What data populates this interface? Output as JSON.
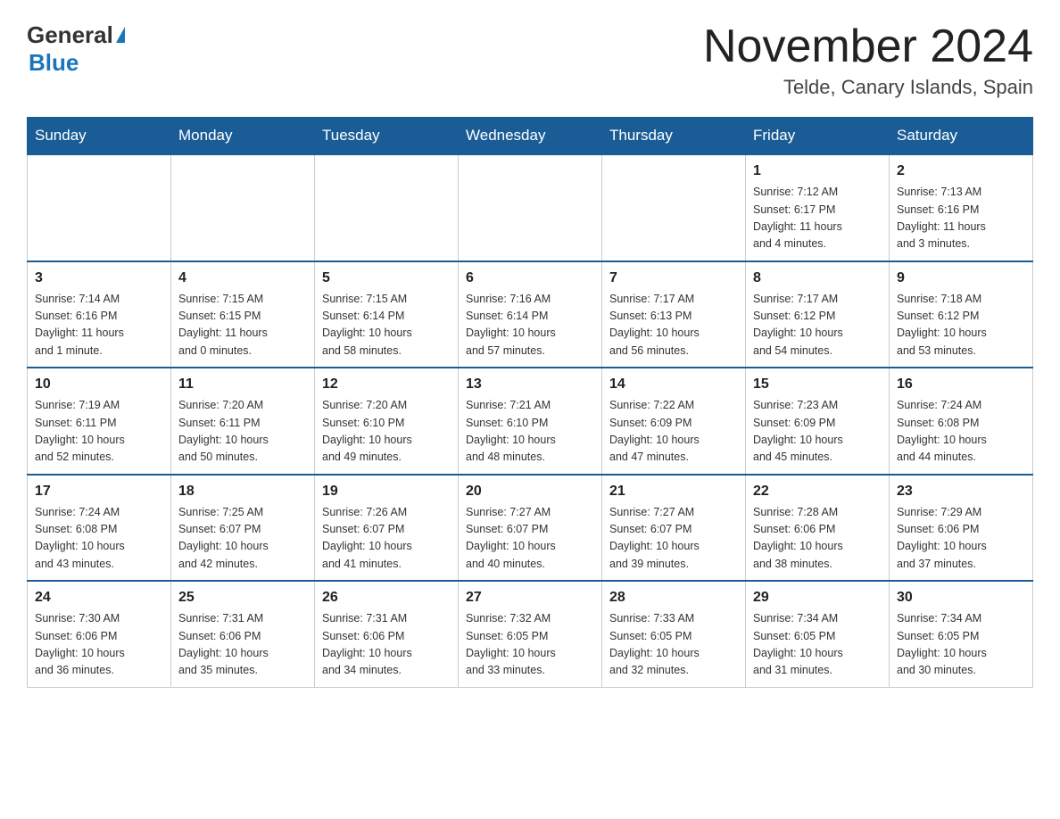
{
  "logo": {
    "general": "General",
    "blue": "Blue"
  },
  "title": {
    "month_year": "November 2024",
    "location": "Telde, Canary Islands, Spain"
  },
  "weekdays": [
    "Sunday",
    "Monday",
    "Tuesday",
    "Wednesday",
    "Thursday",
    "Friday",
    "Saturday"
  ],
  "weeks": [
    [
      {
        "day": "",
        "info": ""
      },
      {
        "day": "",
        "info": ""
      },
      {
        "day": "",
        "info": ""
      },
      {
        "day": "",
        "info": ""
      },
      {
        "day": "",
        "info": ""
      },
      {
        "day": "1",
        "info": "Sunrise: 7:12 AM\nSunset: 6:17 PM\nDaylight: 11 hours\nand 4 minutes."
      },
      {
        "day": "2",
        "info": "Sunrise: 7:13 AM\nSunset: 6:16 PM\nDaylight: 11 hours\nand 3 minutes."
      }
    ],
    [
      {
        "day": "3",
        "info": "Sunrise: 7:14 AM\nSunset: 6:16 PM\nDaylight: 11 hours\nand 1 minute."
      },
      {
        "day": "4",
        "info": "Sunrise: 7:15 AM\nSunset: 6:15 PM\nDaylight: 11 hours\nand 0 minutes."
      },
      {
        "day": "5",
        "info": "Sunrise: 7:15 AM\nSunset: 6:14 PM\nDaylight: 10 hours\nand 58 minutes."
      },
      {
        "day": "6",
        "info": "Sunrise: 7:16 AM\nSunset: 6:14 PM\nDaylight: 10 hours\nand 57 minutes."
      },
      {
        "day": "7",
        "info": "Sunrise: 7:17 AM\nSunset: 6:13 PM\nDaylight: 10 hours\nand 56 minutes."
      },
      {
        "day": "8",
        "info": "Sunrise: 7:17 AM\nSunset: 6:12 PM\nDaylight: 10 hours\nand 54 minutes."
      },
      {
        "day": "9",
        "info": "Sunrise: 7:18 AM\nSunset: 6:12 PM\nDaylight: 10 hours\nand 53 minutes."
      }
    ],
    [
      {
        "day": "10",
        "info": "Sunrise: 7:19 AM\nSunset: 6:11 PM\nDaylight: 10 hours\nand 52 minutes."
      },
      {
        "day": "11",
        "info": "Sunrise: 7:20 AM\nSunset: 6:11 PM\nDaylight: 10 hours\nand 50 minutes."
      },
      {
        "day": "12",
        "info": "Sunrise: 7:20 AM\nSunset: 6:10 PM\nDaylight: 10 hours\nand 49 minutes."
      },
      {
        "day": "13",
        "info": "Sunrise: 7:21 AM\nSunset: 6:10 PM\nDaylight: 10 hours\nand 48 minutes."
      },
      {
        "day": "14",
        "info": "Sunrise: 7:22 AM\nSunset: 6:09 PM\nDaylight: 10 hours\nand 47 minutes."
      },
      {
        "day": "15",
        "info": "Sunrise: 7:23 AM\nSunset: 6:09 PM\nDaylight: 10 hours\nand 45 minutes."
      },
      {
        "day": "16",
        "info": "Sunrise: 7:24 AM\nSunset: 6:08 PM\nDaylight: 10 hours\nand 44 minutes."
      }
    ],
    [
      {
        "day": "17",
        "info": "Sunrise: 7:24 AM\nSunset: 6:08 PM\nDaylight: 10 hours\nand 43 minutes."
      },
      {
        "day": "18",
        "info": "Sunrise: 7:25 AM\nSunset: 6:07 PM\nDaylight: 10 hours\nand 42 minutes."
      },
      {
        "day": "19",
        "info": "Sunrise: 7:26 AM\nSunset: 6:07 PM\nDaylight: 10 hours\nand 41 minutes."
      },
      {
        "day": "20",
        "info": "Sunrise: 7:27 AM\nSunset: 6:07 PM\nDaylight: 10 hours\nand 40 minutes."
      },
      {
        "day": "21",
        "info": "Sunrise: 7:27 AM\nSunset: 6:07 PM\nDaylight: 10 hours\nand 39 minutes."
      },
      {
        "day": "22",
        "info": "Sunrise: 7:28 AM\nSunset: 6:06 PM\nDaylight: 10 hours\nand 38 minutes."
      },
      {
        "day": "23",
        "info": "Sunrise: 7:29 AM\nSunset: 6:06 PM\nDaylight: 10 hours\nand 37 minutes."
      }
    ],
    [
      {
        "day": "24",
        "info": "Sunrise: 7:30 AM\nSunset: 6:06 PM\nDaylight: 10 hours\nand 36 minutes."
      },
      {
        "day": "25",
        "info": "Sunrise: 7:31 AM\nSunset: 6:06 PM\nDaylight: 10 hours\nand 35 minutes."
      },
      {
        "day": "26",
        "info": "Sunrise: 7:31 AM\nSunset: 6:06 PM\nDaylight: 10 hours\nand 34 minutes."
      },
      {
        "day": "27",
        "info": "Sunrise: 7:32 AM\nSunset: 6:05 PM\nDaylight: 10 hours\nand 33 minutes."
      },
      {
        "day": "28",
        "info": "Sunrise: 7:33 AM\nSunset: 6:05 PM\nDaylight: 10 hours\nand 32 minutes."
      },
      {
        "day": "29",
        "info": "Sunrise: 7:34 AM\nSunset: 6:05 PM\nDaylight: 10 hours\nand 31 minutes."
      },
      {
        "day": "30",
        "info": "Sunrise: 7:34 AM\nSunset: 6:05 PM\nDaylight: 10 hours\nand 30 minutes."
      }
    ]
  ]
}
